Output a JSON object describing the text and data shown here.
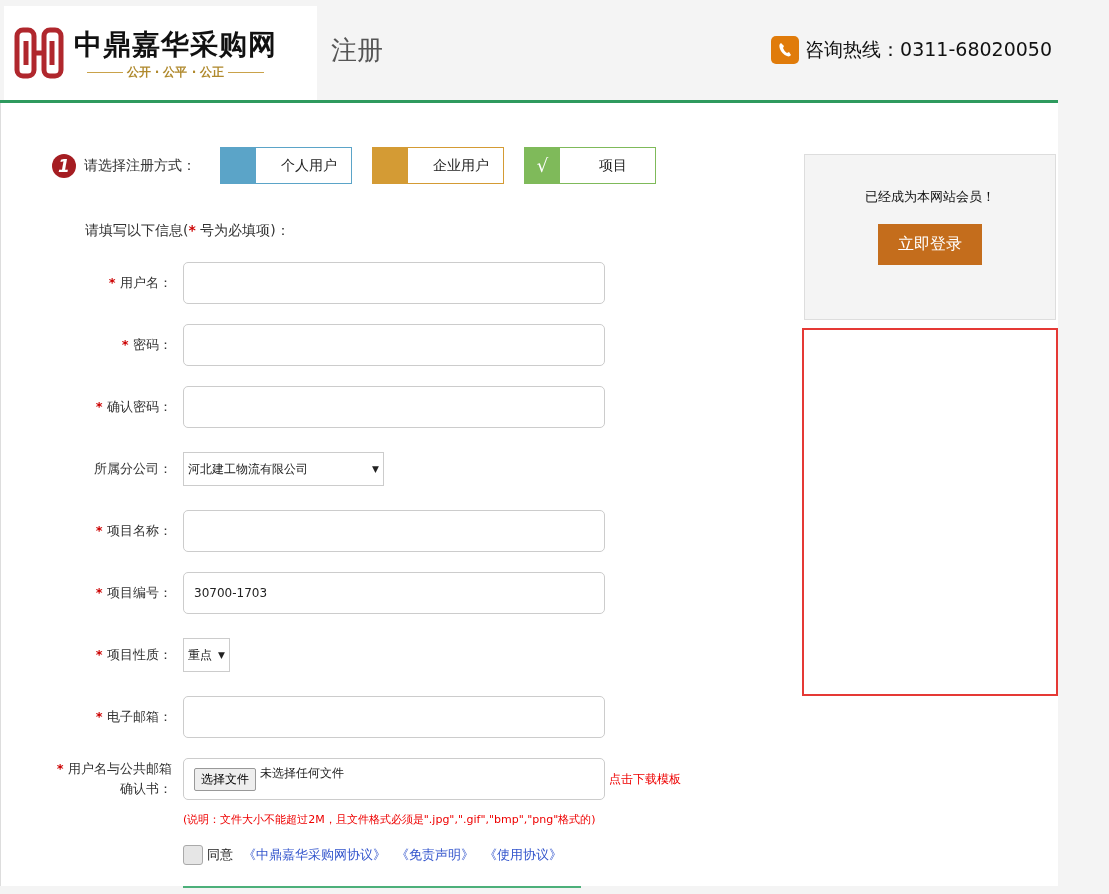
{
  "header": {
    "logo_title": "中鼎嘉华采购网",
    "logo_slogan": "公开 · 公平 · 公正",
    "page_title": "注册",
    "hotline": "咨询热线：0311-68020050"
  },
  "registration": {
    "step": "1",
    "prompt": "请选择注册方式：",
    "check_mark": "√",
    "types": [
      {
        "label": "个人用户",
        "color": "#5ba4c8",
        "selected": false
      },
      {
        "label": "企业用户",
        "color": "#d49b34",
        "selected": false
      },
      {
        "label": "项目",
        "color": "#7fba5a",
        "selected": true
      }
    ]
  },
  "form": {
    "intro_before": "请填写以下信息(",
    "intro_star": "*",
    "intro_after": " 号为必填项)：",
    "required_mark": "*",
    "fields": [
      {
        "kind": "text",
        "label": "用户名：",
        "required": true
      },
      {
        "kind": "text",
        "label": "密码：",
        "required": true
      },
      {
        "kind": "text",
        "label": "确认密码：",
        "required": true
      },
      {
        "kind": "select",
        "label": "所属分公司：",
        "required": false,
        "value": "河北建工物流有限公司",
        "caret": "▼"
      },
      {
        "kind": "text",
        "label": "项目名称：",
        "required": true
      },
      {
        "kind": "text",
        "label": "项目编号：",
        "required": true,
        "value": "30700-1703"
      },
      {
        "kind": "select",
        "label": "项目性质：",
        "required": true,
        "value": "重点",
        "caret": "▼"
      },
      {
        "kind": "text",
        "label": "电子邮箱：",
        "required": true
      },
      {
        "kind": "file",
        "label": "用户名与公共邮箱确认书：",
        "required": true,
        "button": "选择文件",
        "status": "未选择任何文件",
        "link": "点击下载模板"
      }
    ],
    "note": "(说明：文件大小不能超过2M，且文件格式必须是\".jpg\",\".gif\",\"bmp\",\"png\"格式的)",
    "agree": {
      "checked": false,
      "label": "同意",
      "links": [
        "《中鼎嘉华采购网协议》",
        "《免责声明》",
        "《使用协议》"
      ]
    }
  },
  "sidebar": {
    "member_text": "已经成为本网站会员！",
    "login_button": "立即登录"
  }
}
